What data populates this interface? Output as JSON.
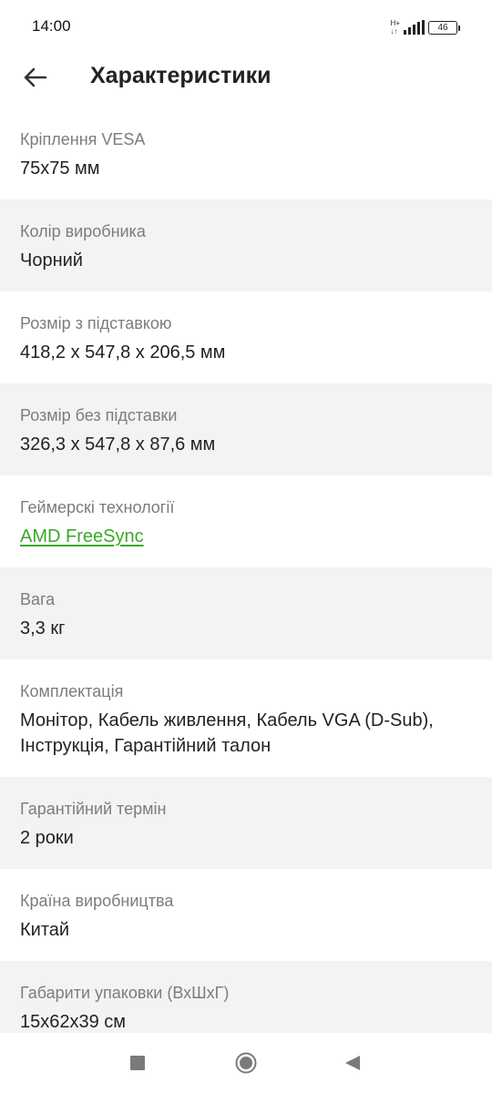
{
  "status_bar": {
    "time": "14:00",
    "network_type_top": "H+",
    "network_type_bottom": "↓↑",
    "battery_level": "46",
    "signal_icon": "cell-signal-icon",
    "battery_icon": "battery-icon"
  },
  "header": {
    "back_icon": "arrow-left-icon",
    "title": "Характеристики"
  },
  "specs": [
    {
      "label": "Кріплення VESA",
      "value": "75x75 мм"
    },
    {
      "label": "Колір виробника",
      "value": "Чорний"
    },
    {
      "label": "Розмір з підставкою",
      "value": "418,2 x 547,8 x 206,5 мм"
    },
    {
      "label": "Розмір без підставки",
      "value": "326,3 x 547,8 x 87,6 мм"
    },
    {
      "label": "Геймерскі технології",
      "value": "AMD FreeSync"
    },
    {
      "label": "Вага",
      "value": "3,3 кг"
    },
    {
      "label": "Комплектація",
      "value": "Монітор, Кабель живлення, Кабель VGA (D-Sub), Інструкція, Гарантійний талон"
    },
    {
      "label": "Гарантійний термін",
      "value": "2 роки"
    },
    {
      "label": "Країна виробництва",
      "value": "Китай"
    },
    {
      "label": "Габарити упаковки (ВхШхГ)",
      "value": "15x62x39 см"
    }
  ],
  "colors": {
    "link": "#3aa928",
    "alt_row_background": "#f2f3f2",
    "label_text": "#7c7c7c",
    "value_text": "#222222"
  },
  "nav_bar": {
    "recent_icon": "square-recents-icon",
    "home_icon": "circle-home-icon",
    "back_icon": "triangle-back-icon"
  }
}
